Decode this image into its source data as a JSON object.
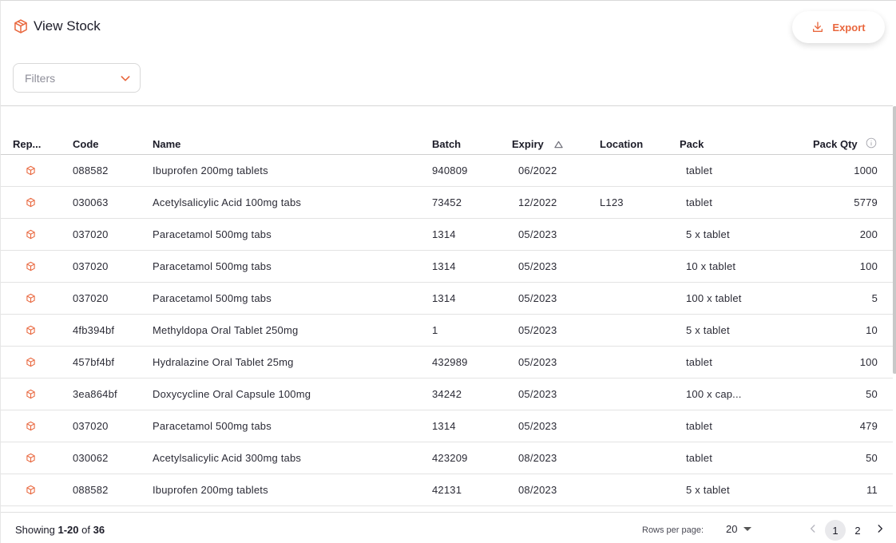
{
  "page": {
    "title": "View Stock",
    "export_label": "Export",
    "filter_placeholder": "Filters"
  },
  "colors": {
    "accent": "#e9683f",
    "text": "#1c1c28",
    "border": "#d9d9d9"
  },
  "table": {
    "columns": [
      "Rep...",
      "Code",
      "Name",
      "Batch",
      "Expiry",
      "Location",
      "Pack",
      "Pack Qty"
    ],
    "sorted_column": "Expiry",
    "sort_direction": "ascending",
    "rows": [
      {
        "code": "088582",
        "name": "Ibuprofen 200mg tablets",
        "batch": "940809",
        "expiry": "06/2022",
        "location": "",
        "pack": "tablet",
        "qty": "1000"
      },
      {
        "code": "030063",
        "name": "Acetylsalicylic Acid 100mg tabs",
        "batch": "73452",
        "expiry": "12/2022",
        "location": "L123",
        "pack": "tablet",
        "qty": "5779"
      },
      {
        "code": "037020",
        "name": "Paracetamol 500mg tabs",
        "batch": "1314",
        "expiry": "05/2023",
        "location": "",
        "pack": "5 x tablet",
        "qty": "200"
      },
      {
        "code": "037020",
        "name": "Paracetamol 500mg tabs",
        "batch": "1314",
        "expiry": "05/2023",
        "location": "",
        "pack": "10 x tablet",
        "qty": "100"
      },
      {
        "code": "037020",
        "name": "Paracetamol 500mg tabs",
        "batch": "1314",
        "expiry": "05/2023",
        "location": "",
        "pack": "100 x tablet",
        "qty": "5"
      },
      {
        "code": "4fb394bf",
        "name": "Methyldopa Oral Tablet 250mg",
        "batch": "1",
        "expiry": "05/2023",
        "location": "",
        "pack": "5 x tablet",
        "qty": "10"
      },
      {
        "code": "457bf4bf",
        "name": "Hydralazine Oral Tablet 25mg",
        "batch": "432989",
        "expiry": "05/2023",
        "location": "",
        "pack": "tablet",
        "qty": "100"
      },
      {
        "code": "3ea864bf",
        "name": "Doxycycline Oral Capsule 100mg",
        "batch": "34242",
        "expiry": "05/2023",
        "location": "",
        "pack": "100 x cap...",
        "qty": "50"
      },
      {
        "code": "037020",
        "name": "Paracetamol 500mg tabs",
        "batch": "1314",
        "expiry": "05/2023",
        "location": "",
        "pack": "tablet",
        "qty": "479"
      },
      {
        "code": "030062",
        "name": "Acetylsalicylic Acid 300mg tabs",
        "batch": "423209",
        "expiry": "08/2023",
        "location": "",
        "pack": "tablet",
        "qty": "50"
      },
      {
        "code": "088582",
        "name": "Ibuprofen 200mg tablets",
        "batch": "42131",
        "expiry": "08/2023",
        "location": "",
        "pack": "5 x tablet",
        "qty": "11"
      }
    ]
  },
  "footer": {
    "showing_prefix": "Showing ",
    "showing_range": "1-20",
    "showing_of": " of ",
    "showing_total": "36",
    "rows_per_page_label": "Rows per page:",
    "rows_per_page_value": "20",
    "pages": [
      "1",
      "2"
    ],
    "current_page": "1"
  }
}
